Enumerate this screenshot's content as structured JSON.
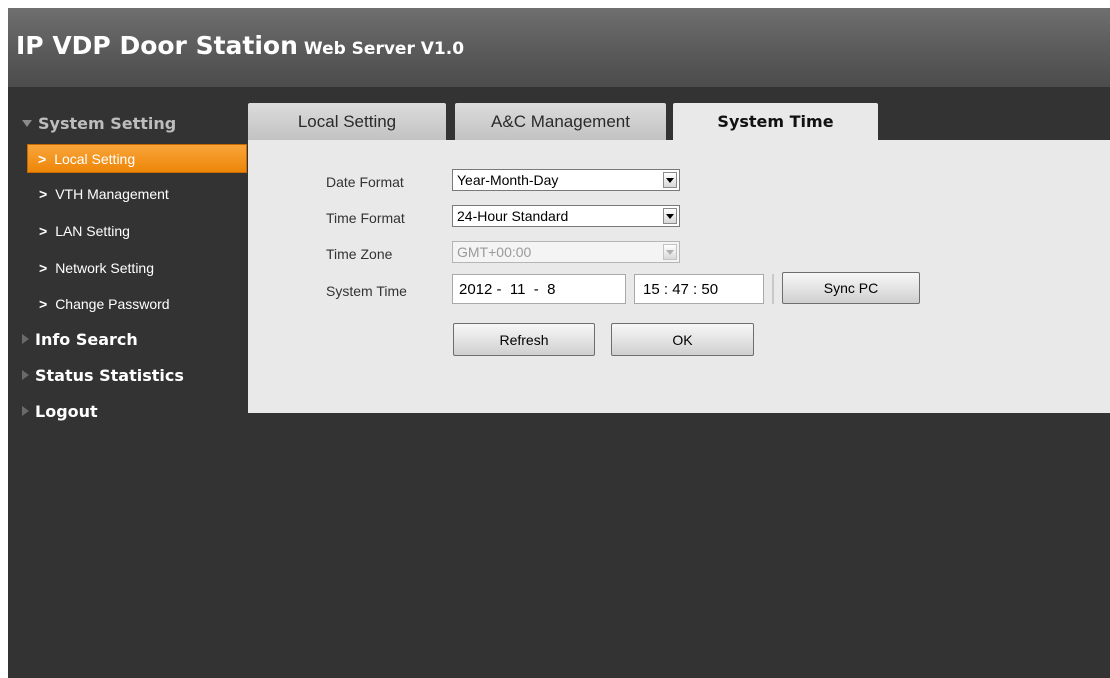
{
  "header": {
    "title": "IP VDP Door Station",
    "subtitle": "Web Server V1.0"
  },
  "sidebar": {
    "sections": [
      {
        "label": "System Setting",
        "expanded": true,
        "items": [
          {
            "label": "Local Setting",
            "active": true
          },
          {
            "label": "VTH Management"
          },
          {
            "label": "LAN Setting"
          },
          {
            "label": "Network Setting"
          },
          {
            "label": "Change Password"
          }
        ]
      },
      {
        "label": "Info Search"
      },
      {
        "label": "Status Statistics"
      },
      {
        "label": "Logout"
      }
    ]
  },
  "tabs": [
    {
      "label": "Local Setting"
    },
    {
      "label": "A&C Management"
    },
    {
      "label": "System Time",
      "active": true
    }
  ],
  "form": {
    "date_format": {
      "label": "Date Format",
      "value": "Year-Month-Day"
    },
    "time_format": {
      "label": "Time Format",
      "value": "24-Hour Standard"
    },
    "time_zone": {
      "label": "Time Zone",
      "value": "GMT+00:00",
      "disabled": true
    },
    "system_time": {
      "label": "System Time",
      "date": {
        "year": "2012",
        "month": "11",
        "day": "8"
      },
      "time": {
        "hour": "15",
        "minute": "47",
        "second": "50"
      },
      "sync_label": "Sync PC"
    },
    "refresh_label": "Refresh",
    "ok_label": "OK"
  },
  "colors": {
    "active_item": "#f19a1f",
    "background": "#333333",
    "panel": "#e9e9e9"
  }
}
